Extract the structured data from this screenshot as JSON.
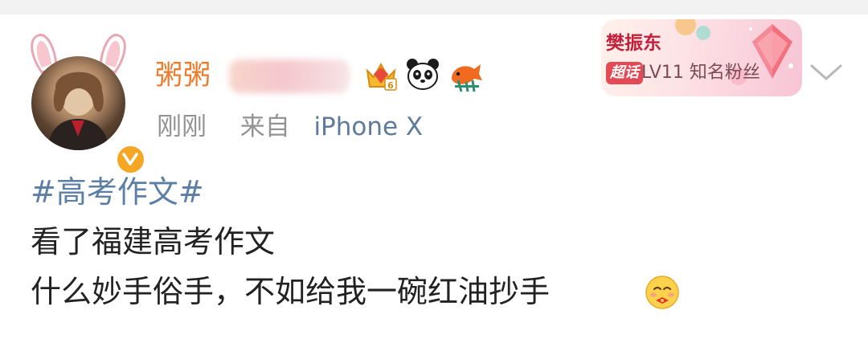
{
  "post": {
    "author": {
      "username": "粥粥",
      "avatar_alt": "avatar",
      "verified": true,
      "badges": [
        "crown-badge-icon",
        "panda-icon",
        "koi-fish-icon"
      ]
    },
    "meta": {
      "time": "刚刚",
      "source_prefix": "来自",
      "device": "iPhone X"
    },
    "fan_card": {
      "name": "樊振东",
      "tag": "超话",
      "level": "LV11 知名粉丝"
    },
    "content": {
      "hashtag": "#高考作文#",
      "line1": "看了福建高考作文",
      "line2": "什么妙手俗手，不如给我一碗红油抄手"
    }
  },
  "colors": {
    "username": "#f07a2a",
    "hashtag": "#5c7fa6",
    "device": "#5e7a9c",
    "meta": "#939393",
    "fan_name": "#c5203a",
    "verify": "#f5a623"
  }
}
